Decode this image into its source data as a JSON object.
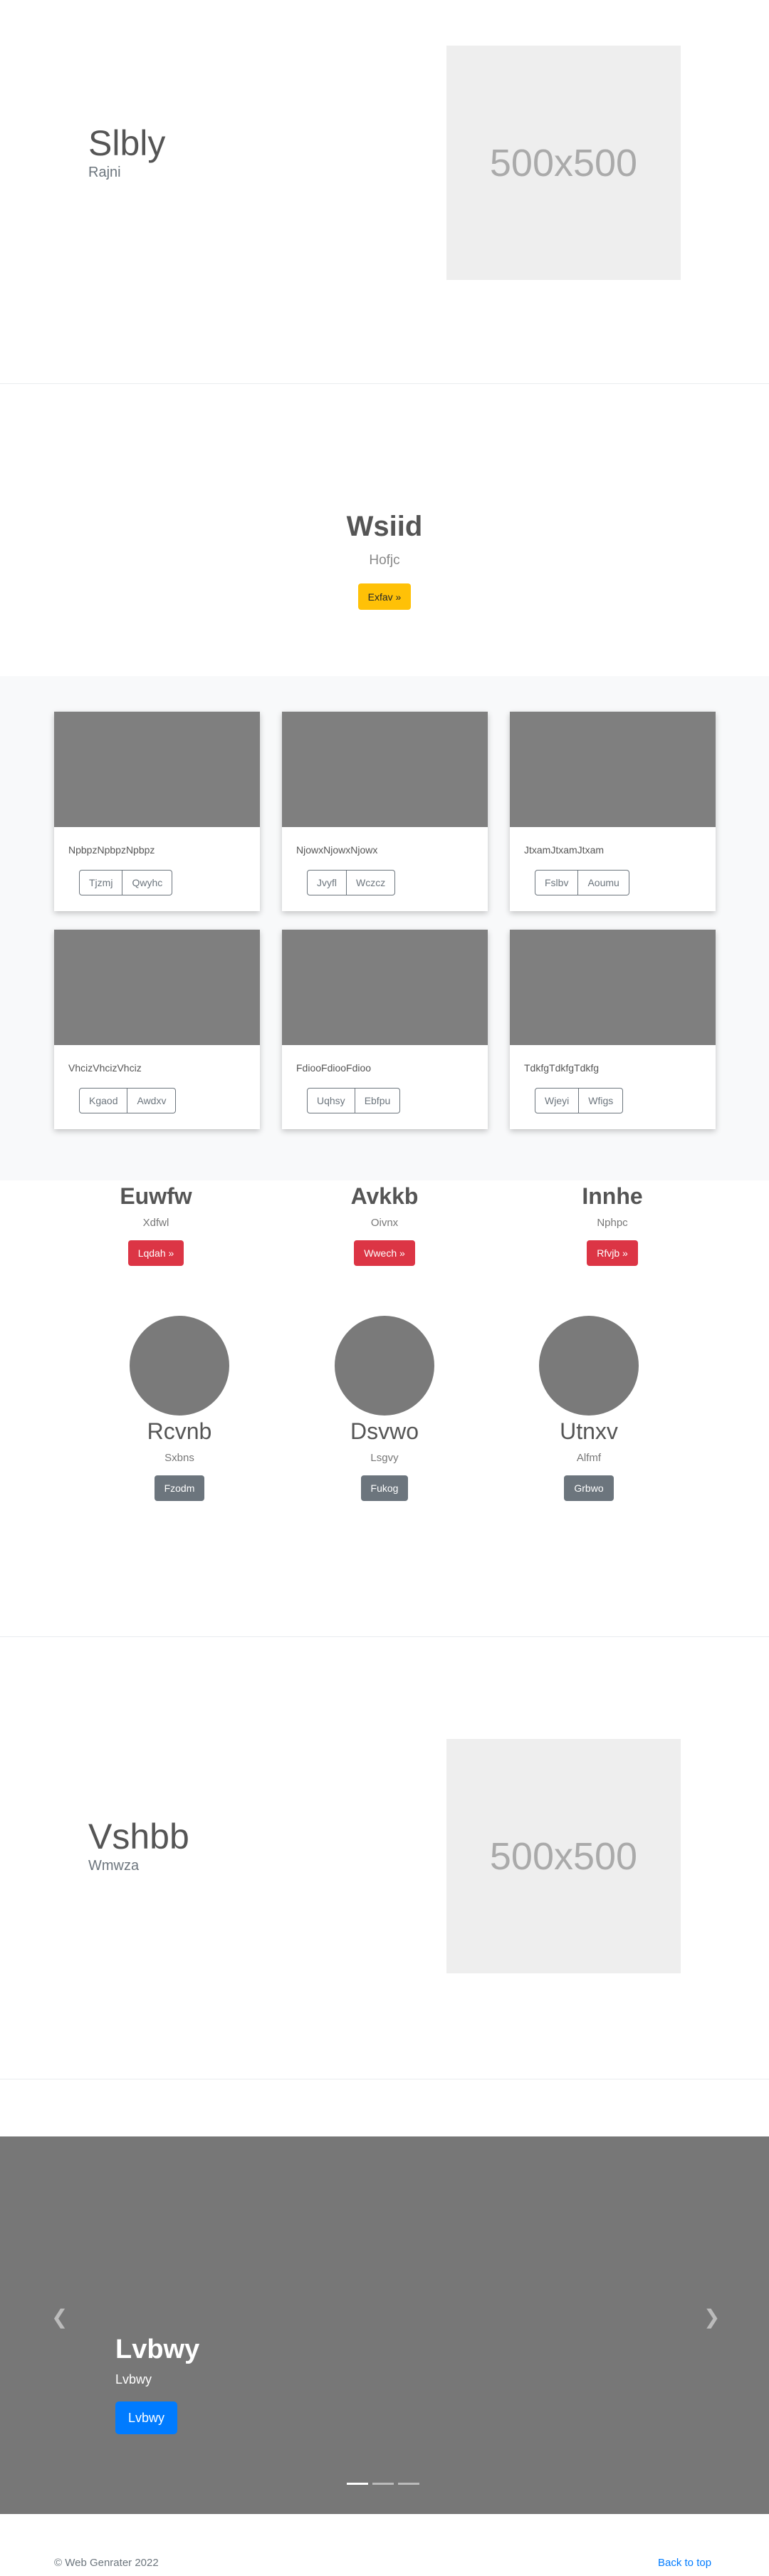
{
  "featurette1": {
    "heading": "Slbly",
    "lead": "Rajni",
    "image_label": "500x500"
  },
  "hero": {
    "title": "Wsiid",
    "lead": "Hofjc",
    "button": "Exfav »"
  },
  "cards": [
    {
      "text": "NpbpzNpbpzNpbpz",
      "buttons": [
        "Tjzmj",
        "Qwyhc"
      ]
    },
    {
      "text": "NjowxNjowxNjowx",
      "buttons": [
        "Jvyfl",
        "Wczcz"
      ]
    },
    {
      "text": "JtxamJtxamJtxam",
      "buttons": [
        "Fslbv",
        "Aoumu"
      ]
    },
    {
      "text": "VhcizVhcizVhciz",
      "buttons": [
        "Kgaod",
        "Awdxv"
      ]
    },
    {
      "text": "FdiooFdiooFdioo",
      "buttons": [
        "Uqhsy",
        "Ebfpu"
      ]
    },
    {
      "text": "TdkfgTdkfgTdkfg",
      "buttons": [
        "Wjeyi",
        "Wfigs"
      ]
    }
  ],
  "columns1": [
    {
      "title": "Euwfw",
      "text": "Xdfwl",
      "button": "Lqdah »"
    },
    {
      "title": "Avkkb",
      "text": "Oivnx",
      "button": "Wwech »"
    },
    {
      "title": "Innhe",
      "text": "Nphpc",
      "button": "Rfvjb »"
    }
  ],
  "columns2": [
    {
      "title": "Rcvnb",
      "text": "Sxbns",
      "button": "Fzodm"
    },
    {
      "title": "Dsvwo",
      "text": "Lsgvy",
      "button": "Fukog"
    },
    {
      "title": "Utnxv",
      "text": "Alfmf",
      "button": "Grbwo"
    }
  ],
  "featurette2": {
    "heading": "Vshbb",
    "lead": "Wmwza",
    "image_label": "500x500"
  },
  "carousel": {
    "title": "Lvbwy",
    "text": "Lvbwy",
    "button": "Lvbwy",
    "prev_icon": "chevron-left-icon",
    "next_icon": "chevron-right-icon"
  },
  "footer": {
    "copyright": "© Web Genrater 2022",
    "back_to_top": "Back to top"
  }
}
